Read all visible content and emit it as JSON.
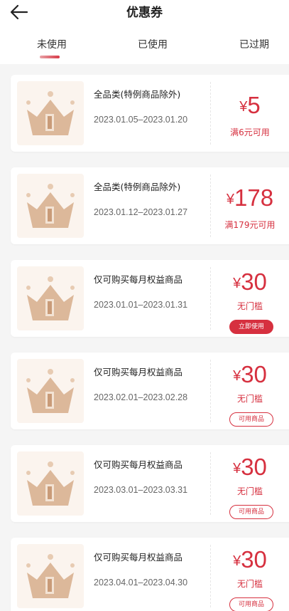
{
  "header": {
    "title": "优惠券"
  },
  "tabs": [
    {
      "label": "未使用"
    },
    {
      "label": "已使用"
    },
    {
      "label": "已过期"
    }
  ],
  "coupons": [
    {
      "name": "全品类(特例商品除外)",
      "date": "2023.01.05–2023.01.20",
      "currency": "¥",
      "amount": "5",
      "condition": "满6元可用",
      "button": ""
    },
    {
      "name": "全品类(特例商品除外)",
      "date": "2023.01.12–2023.01.27",
      "currency": "¥",
      "amount": "178",
      "condition": "满179元可用",
      "button": ""
    },
    {
      "name": "仅可购买每月权益商品",
      "date": "2023.01.01–2023.01.31",
      "currency": "¥",
      "amount": "30",
      "condition": "无门槛",
      "button": "立即使用"
    },
    {
      "name": "仅可购买每月权益商品",
      "date": "2023.02.01–2023.02.28",
      "currency": "¥",
      "amount": "30",
      "condition": "无门槛",
      "button": "可用商品"
    },
    {
      "name": "仅可购买每月权益商品",
      "date": "2023.03.01–2023.03.31",
      "currency": "¥",
      "amount": "30",
      "condition": "无门槛",
      "button": "可用商品"
    },
    {
      "name": "仅可购买每月权益商品",
      "date": "2023.04.01–2023.04.30",
      "currency": "¥",
      "amount": "30",
      "condition": "无门槛",
      "button": "可用商品"
    }
  ],
  "colors": {
    "accent": "#d6303f",
    "page_bg": "#f5f5f5",
    "crown": "#dcb89a"
  },
  "icons": {
    "back": "arrow-left-icon",
    "thumbnail": "crown-icon"
  }
}
